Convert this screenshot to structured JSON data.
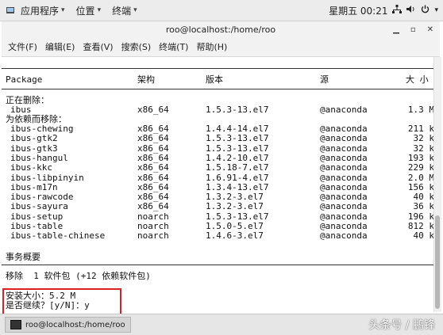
{
  "top_panel": {
    "applications": "应用程序",
    "places": "位置",
    "terminal": "终端",
    "clock": "星期五 00:21"
  },
  "window": {
    "title": "roo@localhost:/home/roo"
  },
  "menubar": {
    "items": [
      "文件(F)",
      "编辑(E)",
      "查看(V)",
      "搜索(S)",
      "终端(T)",
      "帮助(H)"
    ]
  },
  "terminal": {
    "header": {
      "package": "Package",
      "arch": "架构",
      "version": "版本",
      "repo": "源",
      "size": "大 小"
    },
    "removing_label": "正在删除：",
    "dep_label": "为依赖而移除：",
    "main_package": {
      "name": "ibus",
      "arch": "x86_64",
      "version": "1.5.3-13.el7",
      "repo": "@anaconda",
      "size": "1.3 M"
    },
    "dependencies": [
      {
        "name": "ibus-chewing",
        "arch": "x86_64",
        "version": "1.4.4-14.el7",
        "repo": "@anaconda",
        "size": "211 k"
      },
      {
        "name": "ibus-gtk2",
        "arch": "x86_64",
        "version": "1.5.3-13.el7",
        "repo": "@anaconda",
        "size": "32 k"
      },
      {
        "name": "ibus-gtk3",
        "arch": "x86_64",
        "version": "1.5.3-13.el7",
        "repo": "@anaconda",
        "size": "32 k"
      },
      {
        "name": "ibus-hangul",
        "arch": "x86_64",
        "version": "1.4.2-10.el7",
        "repo": "@anaconda",
        "size": "193 k"
      },
      {
        "name": "ibus-kkc",
        "arch": "x86_64",
        "version": "1.5.18-7.el7",
        "repo": "@anaconda",
        "size": "229 k"
      },
      {
        "name": "ibus-libpinyin",
        "arch": "x86_64",
        "version": "1.6.91-4.el7",
        "repo": "@anaconda",
        "size": "2.0 M"
      },
      {
        "name": "ibus-m17n",
        "arch": "x86_64",
        "version": "1.3.4-13.el7",
        "repo": "@anaconda",
        "size": "156 k"
      },
      {
        "name": "ibus-rawcode",
        "arch": "x86_64",
        "version": "1.3.2-3.el7",
        "repo": "@anaconda",
        "size": "40 k"
      },
      {
        "name": "ibus-sayura",
        "arch": "x86_64",
        "version": "1.3.2-3.el7",
        "repo": "@anaconda",
        "size": "36 k"
      },
      {
        "name": "ibus-setup",
        "arch": "noarch",
        "version": "1.5.3-13.el7",
        "repo": "@anaconda",
        "size": "196 k"
      },
      {
        "name": "ibus-table",
        "arch": "noarch",
        "version": "1.5.0-5.el7",
        "repo": "@anaconda",
        "size": "812 k"
      },
      {
        "name": "ibus-table-chinese",
        "arch": "noarch",
        "version": "1.4.6-3.el7",
        "repo": "@anaconda",
        "size": "40 k"
      }
    ],
    "summary_title": "事务概要",
    "remove_summary": "移除  1 软件包 (+12 依赖软件包)",
    "install_size": "安装大小：5.2 M",
    "prompt": "是否继续？[y/N]：y"
  },
  "taskbar": {
    "task_label": "roo@localhost:/home/roo"
  },
  "watermark": "头条号 / 鹏锋"
}
